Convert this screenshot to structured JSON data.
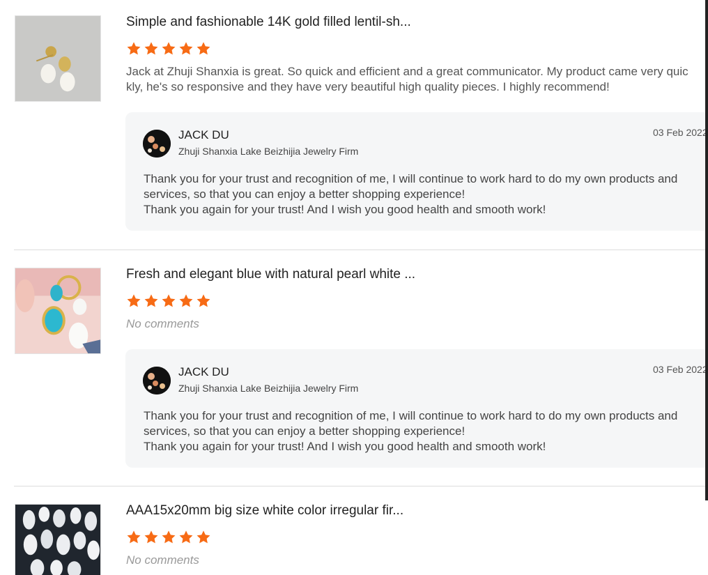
{
  "reviews": [
    {
      "title": "Simple and fashionable 14K gold filled lentil-sh...",
      "rating": 5,
      "comment": "Jack at Zhuji Shanxia is great. So quick and efficient and a great communicator. My product came very quickly, he's so responsive and they have very beautiful high quality pieces. I highly recommend!",
      "reply": {
        "name": "JACK DU",
        "shop": "Zhuji Shanxia Lake Beizhijia Jewelry Firm",
        "date": "03 Feb 2022",
        "line1": "Thank you for your trust and recognition of me, I will continue to work hard to do my own products and services, so that you can enjoy a better shopping experience!",
        "line2": "Thank you again for your trust! And I wish you good health and smooth work!"
      }
    },
    {
      "title": "Fresh and elegant blue with natural pearl white ...",
      "rating": 5,
      "comment": "No comments",
      "reply": {
        "name": "JACK DU",
        "shop": "Zhuji Shanxia Lake Beizhijia Jewelry Firm",
        "date": "03 Feb 2022",
        "line1": "Thank you for your trust and recognition of me, I will continue to work hard to do my own products and services, so that you can enjoy a better shopping experience!",
        "line2": "Thank you again for your trust! And I wish you good health and smooth work!"
      }
    },
    {
      "title": "AAA15x20mm big size white color irregular fir...",
      "rating": 5,
      "comment": "No comments"
    }
  ],
  "colors": {
    "star": "#f76b15",
    "reply_bg": "#f5f6f7",
    "divider": "#dcdcdc"
  }
}
